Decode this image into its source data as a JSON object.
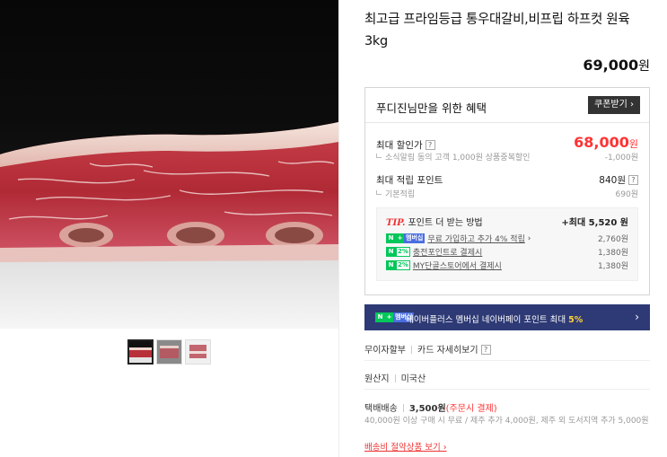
{
  "product": {
    "title": "최고급 프라임등급 통우대갈비,비프립 하프컷 원육 3kg",
    "price": "69,000",
    "price_unit": "원"
  },
  "gallery": {
    "main_image": "beef-short-rib-photo",
    "thumbnails": [
      "thumb-1",
      "thumb-2",
      "thumb-3"
    ]
  },
  "benefit": {
    "heading": "푸디진님만을 위한 혜택",
    "coupon_button": "쿠폰받기 ›",
    "max_discount_label": "최대 할인가",
    "max_discount_price": "68,000",
    "max_discount_unit": "원",
    "discount_sub_label": "소식알림 동의 고객 1,000원 상품중복할인",
    "discount_sub_value": "-1,000원",
    "max_point_label": "최대 적립 포인트",
    "max_point_value": "840원",
    "base_point_label": "기본적립",
    "base_point_value": "690원",
    "tip_label": "TIP.",
    "tip_heading": "포인트 더 받는 방법",
    "tip_max": "+최대 5,520 원",
    "tip_rows": [
      {
        "badge": "멤버십",
        "text": "무료 가입하고 추가 4% 적립",
        "suffix": "›",
        "amount": "2,760원"
      },
      {
        "badge": "2%",
        "text": "충전포인트로 결제시",
        "suffix": "",
        "amount": "1,380원"
      },
      {
        "badge": "2%",
        "text": "MY단골스토어에서 결제시",
        "suffix": "",
        "amount": "1,380원"
      }
    ]
  },
  "naver_banner": {
    "badge_n": "N",
    "badge_plus": "+",
    "badge_member": "멤버십",
    "text": "네이버플러스 멤버십 네이버페이 포인트 최대",
    "pct": "5%",
    "arrow": "›"
  },
  "installment": {
    "label": "무이자할부",
    "card_detail": "카드 자세히보기",
    "help": "?"
  },
  "origin": {
    "label": "원산지",
    "value": "미국산"
  },
  "shipping": {
    "label": "택배배송",
    "fee": "3,500원",
    "fee_note": "(주문시 결제)",
    "note": "40,000원 이상 구매 시 무료 / 제주 추가 4,000원, 제주 외 도서지역 추가 5,000원",
    "link": "배송비 절약상품 보기 ›"
  },
  "colors": {
    "accent_red": "#ff3333",
    "naver_green": "#03c75a",
    "banner_navy": "#2e3a75"
  }
}
